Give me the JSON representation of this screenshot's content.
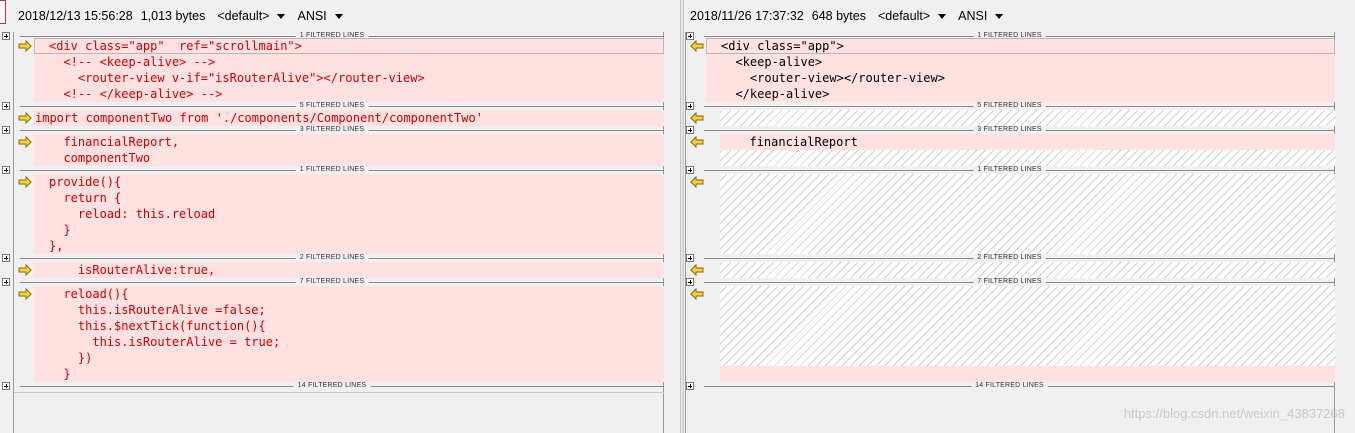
{
  "left": {
    "timestamp": "2018/12/13 15:56:28",
    "size": "1,013 bytes",
    "profile": "<default>",
    "encoding": "ANSI"
  },
  "right": {
    "timestamp": "2018/11/26 17:37:32",
    "size": "648 bytes",
    "profile": "<default>",
    "encoding": "ANSI"
  },
  "filtered": {
    "f1": "1 FILTERED LINES",
    "f2": "5 FILTERED LINES",
    "f3": "3 FILTERED LINES",
    "f4": "1 FILTERED LINES",
    "f5": "2 FILTERED LINES",
    "f6": "7 FILTERED LINES",
    "f7": "14 FILTERED LINES"
  },
  "left_lines": {
    "a1": "<div class=\"app\"  ref=\"scrollmain\">",
    "a2": "  <!-- <keep-alive> -->",
    "a3": "    <router-view v-if=\"isRouterAlive\"></router-view>",
    "a4": "  <!-- </keep-alive> -->",
    "b1": "import componentTwo from './components/Component/componentTwo'",
    "c1": "  financialReport,",
    "c2": "  componentTwo",
    "d1": "provide(){",
    "d2": "  return {",
    "d3": "    reload: this.reload",
    "d4": "  }",
    "d5": "},",
    "e1": "    isRouterAlive:true,",
    "f1": "  reload(){",
    "f2": "    this.isRouterAlive =false;",
    "f3": "    this.$nextTick(function(){",
    "f4": "      this.isRouterAlive = true;",
    "f5": "    })",
    "f6": "  }"
  },
  "right_lines": {
    "a1": "<div class=\"app\">",
    "a2": "  <keep-alive>",
    "a3": "    <router-view></router-view>",
    "a4": "  </keep-alive>",
    "c1": "  financialReport"
  },
  "watermark": "https://blog.csdn.net/weixin_43837268",
  "colors": {
    "diff_bg": "#ffe1e1",
    "diff_text": "#d00000",
    "arrow": "#f5d142"
  }
}
